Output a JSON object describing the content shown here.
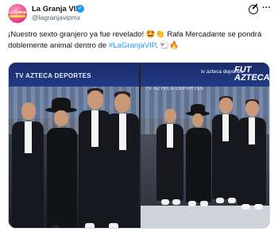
{
  "account": {
    "display_name": "La Granja VIP",
    "handle": "@lagranjavipmx",
    "avatar_text": "La Granja",
    "verified": true
  },
  "tweet": {
    "text_before": "¡Nuestro sexto granjero ya fue revelado! 🤩👏 Rafa Mercadante se pondrá doblemente animal dentro de ",
    "hashtag": "#LaGranjaVIP",
    "text_after": ". 🐑🔥"
  },
  "media": {
    "left_banner": "TV AZTECA DEPORTES",
    "right_brand_small": "tv azteca deportes",
    "right_brand_big": "FUT AZTECA",
    "right_banner": "TV AZTECA DEPORTES"
  },
  "icons": {
    "grok": "grok-icon",
    "more": "more-icon",
    "verified": "verified-badge-icon"
  },
  "colors": {
    "link": "#1d9bf0",
    "text": "#0f1419",
    "muted": "#536471"
  }
}
